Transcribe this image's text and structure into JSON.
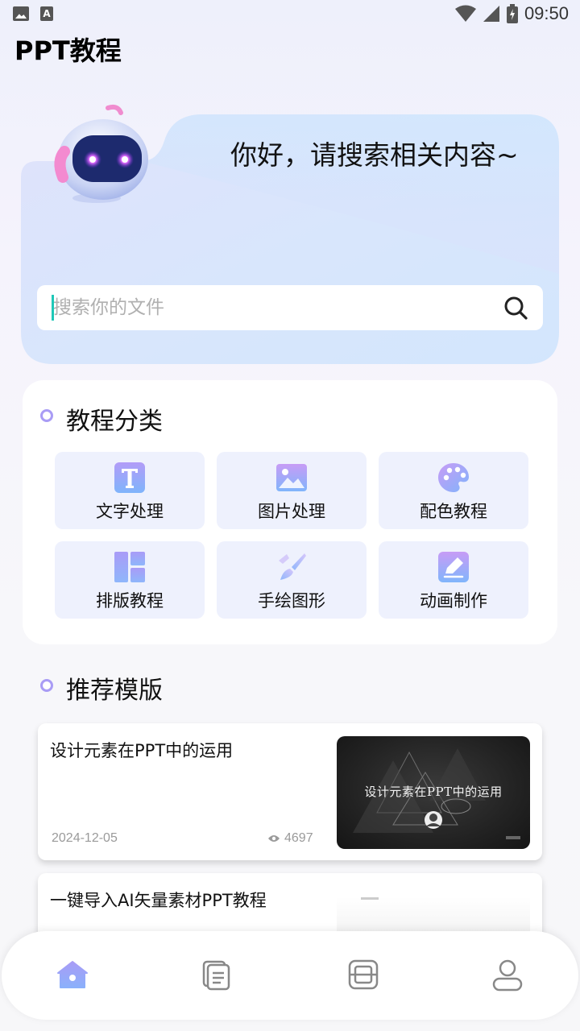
{
  "status_bar": {
    "time": "09:50"
  },
  "app": {
    "title": "PPT教程"
  },
  "hero": {
    "greeting": "你好，请搜索相关内容~",
    "search_placeholder": "搜索你的文件"
  },
  "categories": {
    "title": "教程分类",
    "items": [
      {
        "label": "文字处理",
        "icon": "text-icon"
      },
      {
        "label": "图片处理",
        "icon": "image-icon"
      },
      {
        "label": "配色教程",
        "icon": "palette-icon"
      },
      {
        "label": "排版教程",
        "icon": "layout-icon"
      },
      {
        "label": "手绘图形",
        "icon": "brush-icon"
      },
      {
        "label": "动画制作",
        "icon": "edit-icon"
      }
    ]
  },
  "recommend": {
    "title": "推荐模版",
    "items": [
      {
        "title": "设计元素在PPT中的运用",
        "date": "2024-12-05",
        "views": "4697",
        "thumb_text": "设计元素在PPT中的运用"
      },
      {
        "title": "一键导入AI矢量素材PPT教程"
      }
    ]
  },
  "bottom_nav": [
    {
      "icon": "home-icon",
      "active": true
    },
    {
      "icon": "document-icon",
      "active": false
    },
    {
      "icon": "scan-icon",
      "active": false
    },
    {
      "icon": "user-icon",
      "active": false
    }
  ],
  "colors": {
    "accent": "#a99cf5",
    "active_nav": "#8f8cf2",
    "caret": "#1fc8b8"
  }
}
